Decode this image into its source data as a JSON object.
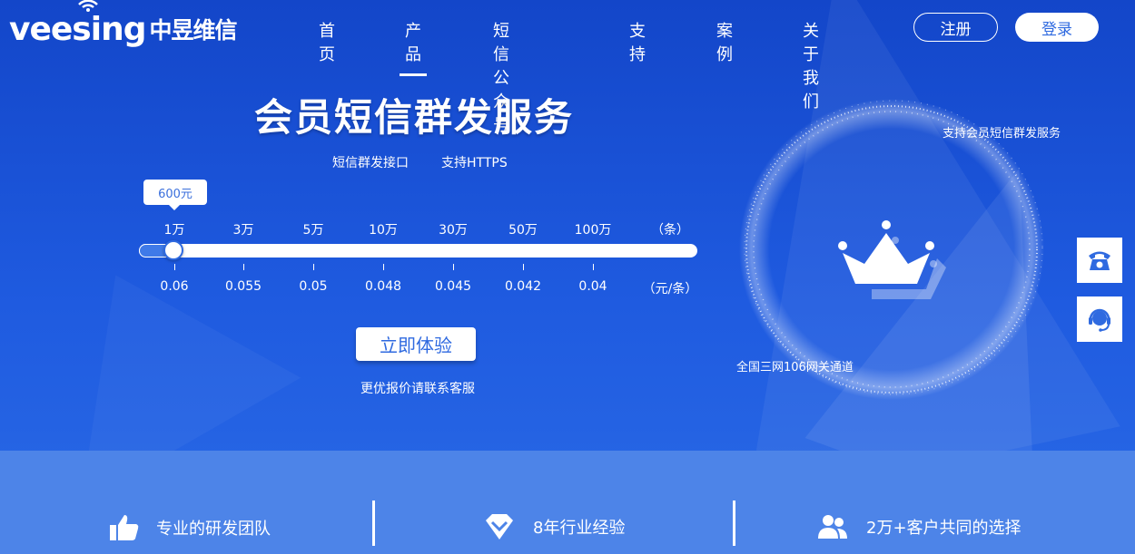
{
  "brand": {
    "logo_text": "veesing",
    "logo_cn": "中昱维信"
  },
  "nav": {
    "items": [
      {
        "label": "首页"
      },
      {
        "label": "产品",
        "active": true
      },
      {
        "label": "短信公众号"
      },
      {
        "label": "支持"
      },
      {
        "label": "案例"
      },
      {
        "label": "关于我们"
      }
    ],
    "register": "注册",
    "login": "登录"
  },
  "hero": {
    "title": "会员短信群发服务",
    "features": [
      "短信群发接口",
      "支持HTTPS"
    ]
  },
  "pricing": {
    "tooltip": "600元",
    "quantities": [
      "1万",
      "3万",
      "5万",
      "10万",
      "30万",
      "50万",
      "100万"
    ],
    "quantity_unit": "（条）",
    "prices": [
      "0.06",
      "0.055",
      "0.05",
      "0.048",
      "0.045",
      "0.042",
      "0.04"
    ],
    "price_unit": "（元/条）",
    "selected_index": 0
  },
  "cta": {
    "button": "立即体验",
    "note": "更优报价请联系客服"
  },
  "ring": {
    "top_label": "支持会员短信群发服务",
    "bottom_label": "全国三网106网关通道"
  },
  "side_tools": [
    "phone-icon",
    "customer-service-icon"
  ],
  "advantages": [
    {
      "icon": "thumbs-up-icon",
      "label": "专业的研发团队"
    },
    {
      "icon": "diamond-icon",
      "label": "8年行业经验"
    },
    {
      "icon": "users-icon",
      "label": "2万+客户共同的选择"
    }
  ],
  "colors": {
    "primary": "#2f6ae0",
    "band": "#4d84e8",
    "background": "#1a52d6"
  }
}
